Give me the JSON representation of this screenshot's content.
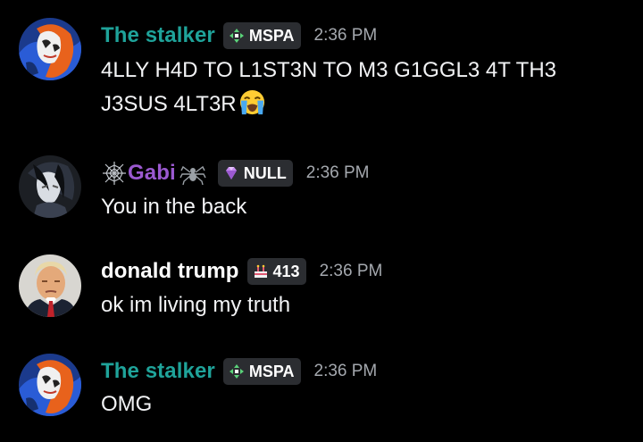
{
  "messages": [
    {
      "username": "The stalker",
      "username_color": "#1fa39a",
      "badge_icon": "fourway-arrows-icon",
      "badge_label": "MSPA",
      "timestamp": "2:36 PM",
      "avatar_icon": "avatar-anime-blue-orange",
      "line1": "4LLY H4D TO L1ST3N TO M3 G1GGL3 4T TH3",
      "line2": "J3SUS 4LT3R",
      "emoji": "loudly-crying-face-emoji"
    },
    {
      "username": "Gabi",
      "username_color": "#9b59d0",
      "prefix_icon": "spider-web-icon",
      "suffix_icon": "spider-icon",
      "badge_icon": "gem-icon",
      "badge_label": "NULL",
      "timestamp": "2:36 PM",
      "avatar_icon": "avatar-anime-dark",
      "text": "You in the back"
    },
    {
      "username": "donald trump",
      "username_color": "#ffffff",
      "badge_icon": "cake-icon",
      "badge_label": "413",
      "timestamp": "2:36 PM",
      "avatar_icon": "avatar-portrait",
      "text": "ok im living my truth"
    },
    {
      "username": "The stalker",
      "username_color": "#1fa39a",
      "badge_icon": "fourway-arrows-icon",
      "badge_label": "MSPA",
      "timestamp": "2:36 PM",
      "avatar_icon": "avatar-anime-blue-orange",
      "text": "OMG"
    }
  ]
}
